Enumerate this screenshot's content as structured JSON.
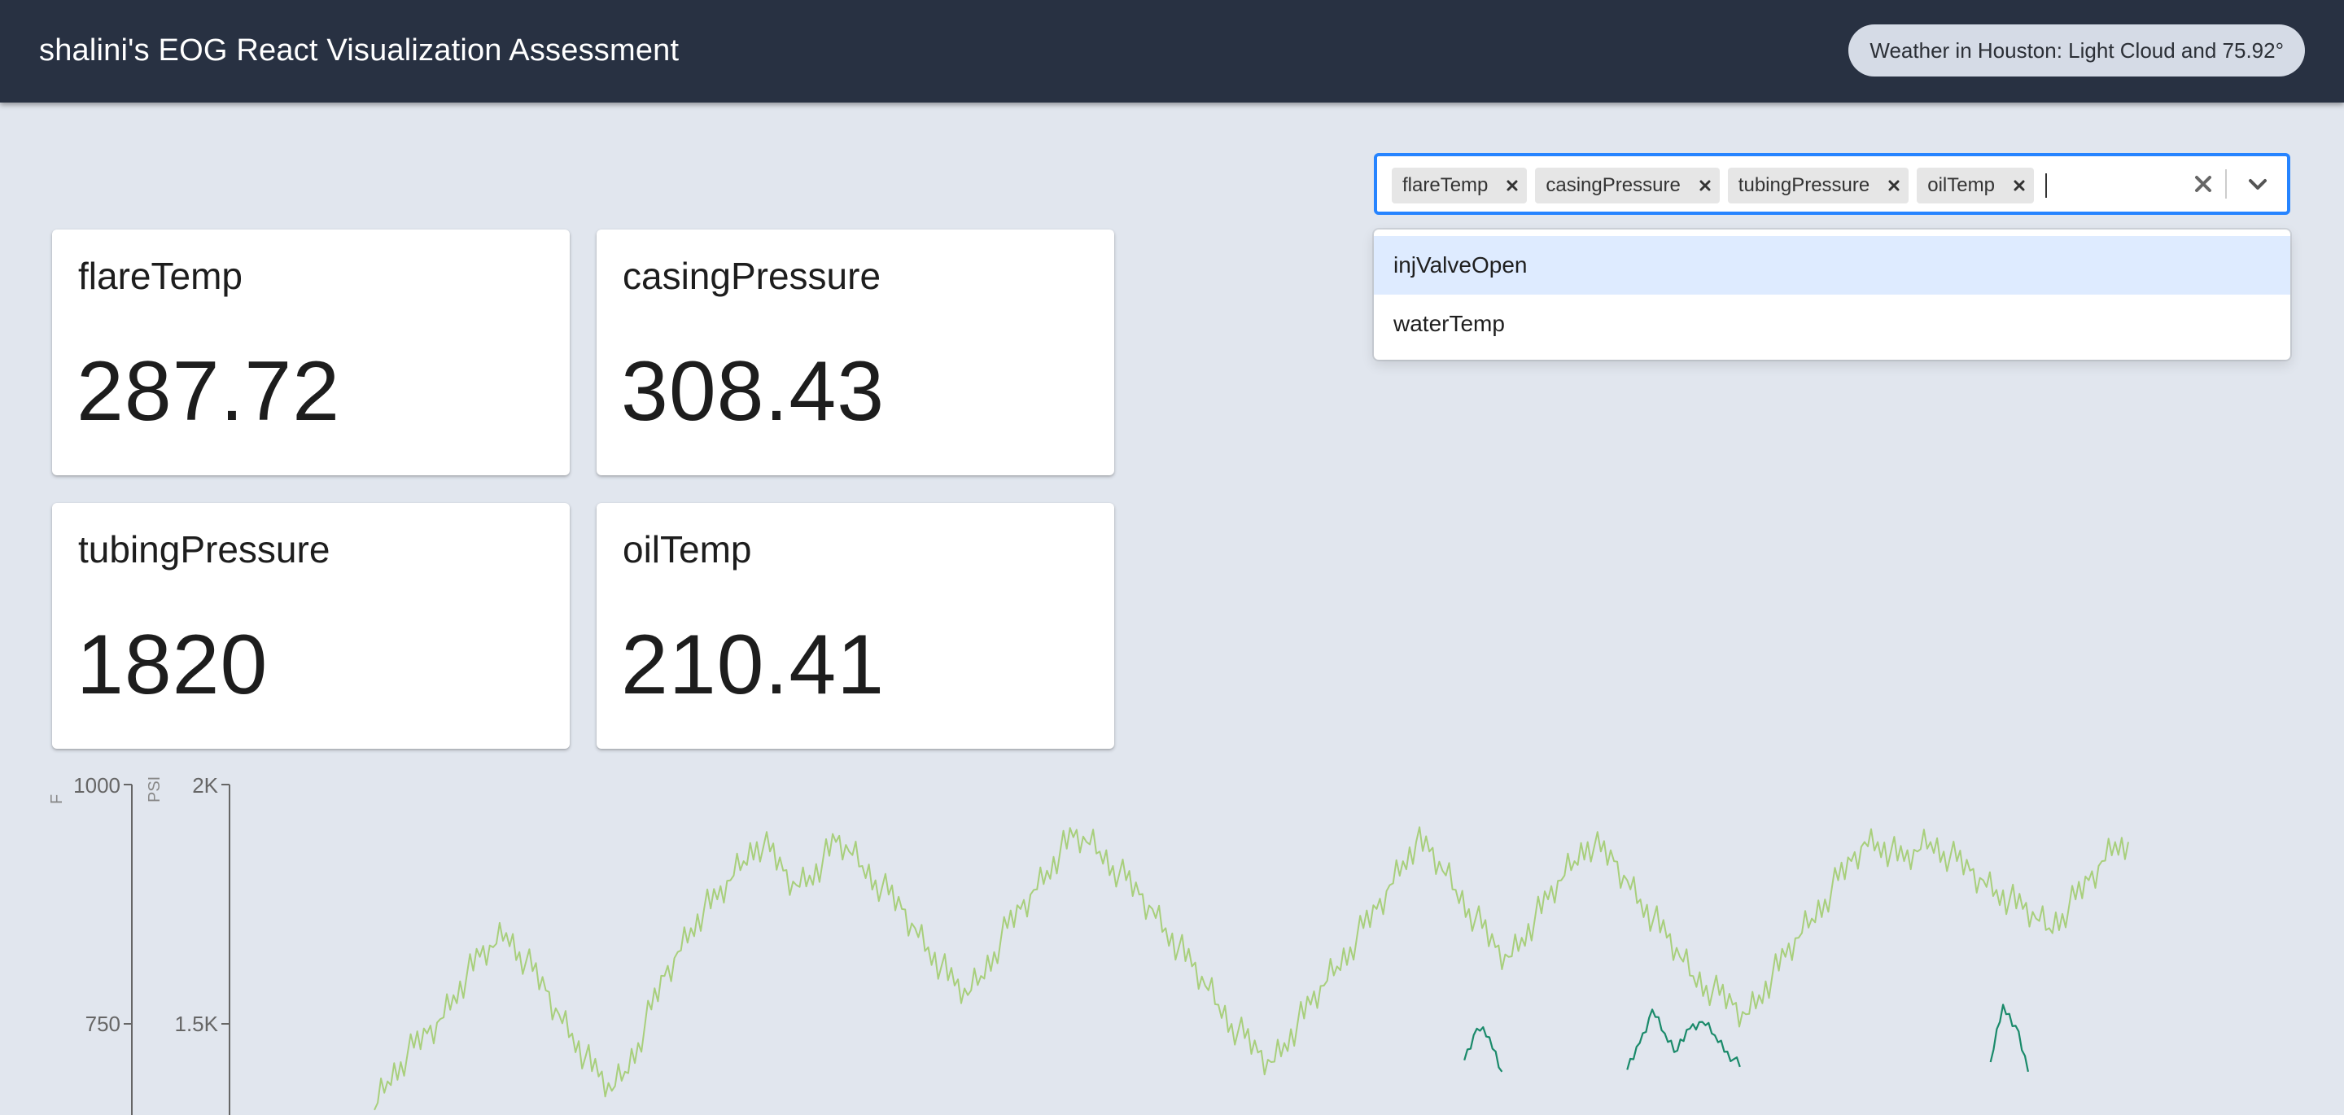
{
  "header": {
    "title": "shalini's EOG React Visualization Assessment",
    "weather": "Weather in Houston: Light Cloud and 75.92°"
  },
  "metric_select": {
    "selected": [
      "flareTemp",
      "casingPressure",
      "tubingPressure",
      "oilTemp"
    ],
    "options": [
      "injValveOpen",
      "waterTemp"
    ],
    "focused_option": "injValveOpen"
  },
  "cards": [
    {
      "title": "flareTemp",
      "value": "287.72"
    },
    {
      "title": "casingPressure",
      "value": "308.43"
    },
    {
      "title": "tubingPressure",
      "value": "1820"
    },
    {
      "title": "oilTemp",
      "value": "210.41"
    }
  ],
  "colors": {
    "header_bg": "#283142",
    "page_bg": "#e1e6ee",
    "focus_border": "#2684ff",
    "series_light_green": "#a8cf7c",
    "series_teal": "#1a8a6a"
  },
  "chart_data": {
    "type": "line",
    "axes": [
      {
        "unit": "F",
        "ticks": [
          "1000",
          "750"
        ],
        "range_visible": [
          750,
          1000
        ]
      },
      {
        "unit": "PSI",
        "ticks": [
          "2K",
          "1.5K"
        ],
        "range_visible": [
          1500,
          2000
        ]
      }
    ],
    "series": [
      {
        "axis": "PSI",
        "color": "#a8cf7c",
        "values": [
          1320,
          1380,
          1420,
          1450,
          1480,
          1510,
          1560,
          1600,
          1640,
          1660,
          1690,
          1650,
          1610,
          1570,
          1520,
          1480,
          1430,
          1390,
          1360,
          1400,
          1460,
          1530,
          1600,
          1650,
          1700,
          1740,
          1760,
          1800,
          1840,
          1880,
          1860,
          1820,
          1790,
          1810,
          1840,
          1880,
          1860,
          1830,
          1800,
          1770,
          1740,
          1700,
          1660,
          1620,
          1580,
          1560,
          1600,
          1650,
          1700,
          1740,
          1780,
          1820,
          1860,
          1890,
          1880,
          1860,
          1830,
          1800,
          1770,
          1740,
          1700,
          1660,
          1620,
          1580,
          1540,
          1500,
          1470,
          1440,
          1420,
          1460,
          1500,
          1540,
          1580,
          1620,
          1660,
          1700,
          1740,
          1790,
          1840,
          1880,
          1860,
          1820,
          1780,
          1740,
          1700,
          1660,
          1640,
          1680,
          1720,
          1760,
          1800,
          1840,
          1880,
          1860,
          1840,
          1800,
          1760,
          1720,
          1680,
          1640,
          1600,
          1580,
          1560,
          1540,
          1520,
          1560,
          1600,
          1640,
          1680,
          1720,
          1760,
          1800,
          1840,
          1880,
          1880,
          1860,
          1840,
          1860,
          1880,
          1860,
          1840,
          1820,
          1800,
          1780,
          1760,
          1740,
          1720,
          1700,
          1730,
          1760,
          1800,
          1840,
          1880,
          1880
        ]
      },
      {
        "axis": "F",
        "color": "#1a8a6a",
        "values": [
          null,
          null,
          null,
          null,
          null,
          null,
          null,
          null,
          null,
          null,
          null,
          null,
          null,
          null,
          null,
          null,
          null,
          null,
          null,
          null,
          null,
          null,
          null,
          null,
          null,
          null,
          null,
          null,
          null,
          null,
          null,
          null,
          null,
          null,
          null,
          null,
          null,
          null,
          null,
          null,
          null,
          null,
          null,
          null,
          null,
          null,
          null,
          null,
          null,
          null,
          null,
          null,
          null,
          null,
          null,
          null,
          null,
          null,
          null,
          null,
          null,
          null,
          null,
          null,
          null,
          null,
          null,
          null,
          null,
          null,
          null,
          null,
          null,
          null,
          null,
          null,
          null,
          null,
          null,
          null,
          null,
          null,
          null,
          null,
          null,
          null,
          null,
          712,
          745,
          736,
          700,
          null,
          null,
          null,
          null,
          null,
          null,
          null,
          null,
          null,
          702,
          730,
          765,
          740,
          722,
          745,
          752,
          738,
          721,
          705,
          null,
          null,
          null,
          null,
          null,
          null,
          null,
          null,
          null,
          null,
          null,
          null,
          null,
          null,
          null,
          null,
          null,
          null,
          null,
          710,
          770,
          748,
          700,
          null,
          null,
          null,
          null,
          null,
          null,
          null,
          null
        ]
      }
    ]
  }
}
